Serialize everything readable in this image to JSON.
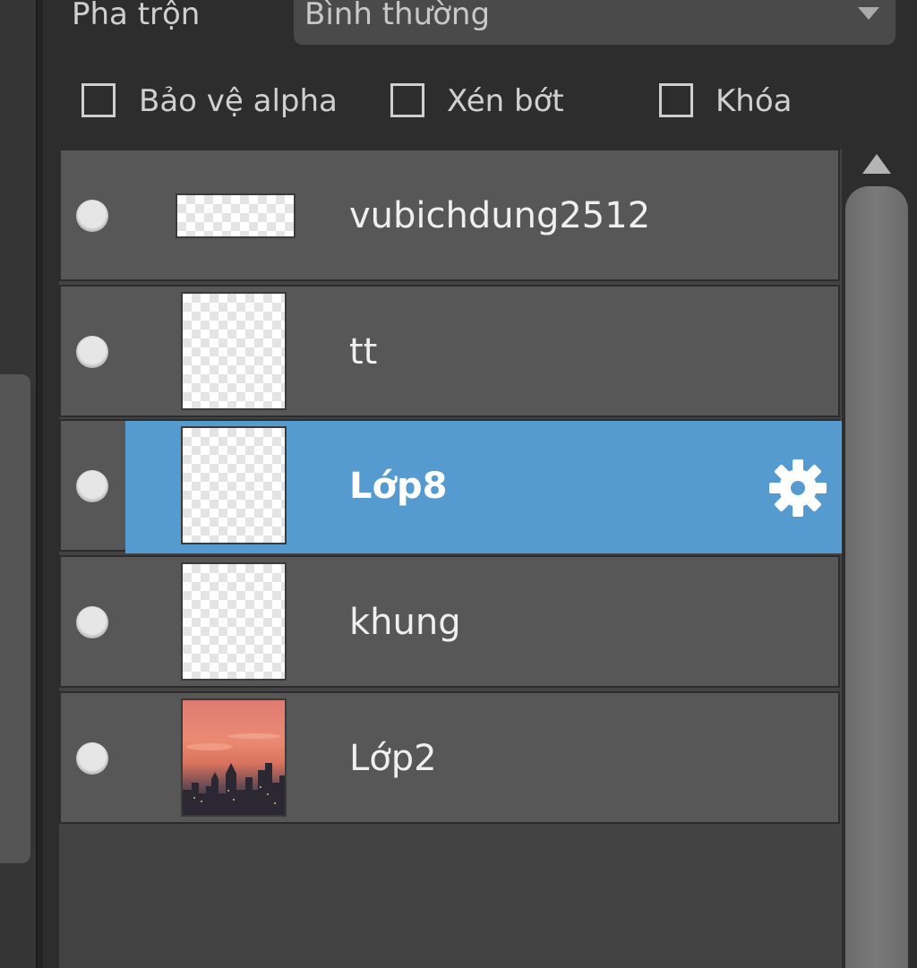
{
  "blend": {
    "label": "Pha trộn",
    "value": "Bình thường"
  },
  "options": {
    "alpha_protect": "Bảo vệ alpha",
    "clip": "Xén bớt",
    "lock": "Khóa"
  },
  "layers": [
    {
      "name": "vubichdung2512",
      "thumb": "checker-wide",
      "selected": false
    },
    {
      "name": "tt",
      "thumb": "checker",
      "selected": false
    },
    {
      "name": "Lớp8",
      "thumb": "checker",
      "selected": true
    },
    {
      "name": "khung",
      "thumb": "checker",
      "selected": false
    },
    {
      "name": "Lớp2",
      "thumb": "photo-city-sunset",
      "selected": false
    }
  ],
  "icons": {
    "visibility": "visibility-dot-icon",
    "settings": "gear-icon",
    "dropdown": "chevron-down-icon",
    "scroll_up": "scroll-up-arrow-icon"
  },
  "colors": {
    "selected_row": "#559bd0",
    "row": "#575757",
    "panel": "#2d2d2d"
  }
}
